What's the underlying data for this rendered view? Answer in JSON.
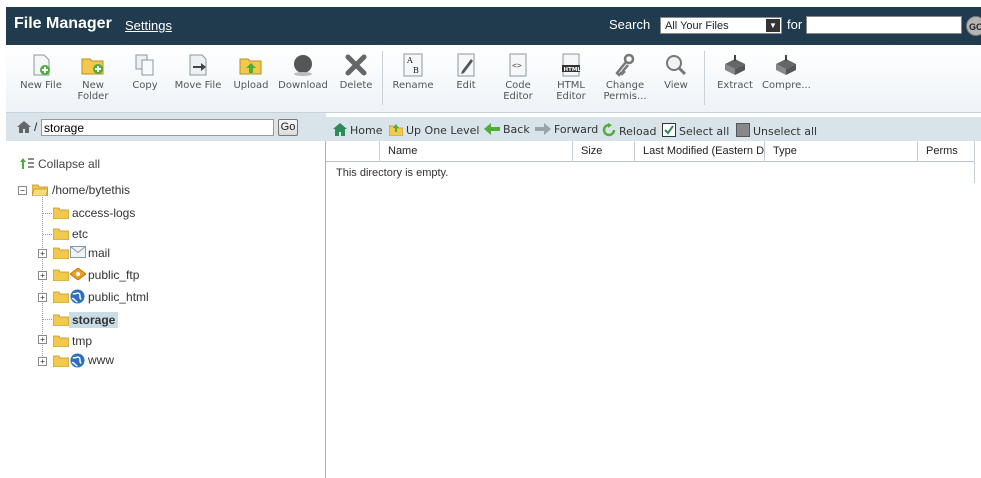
{
  "header": {
    "title": "File Manager",
    "settings": "Settings",
    "search_label": "Search",
    "search_scope": "All Your Files",
    "for_label": "for",
    "search_value": "",
    "go": "GO"
  },
  "toolbar": {
    "new_file": [
      "New File"
    ],
    "new_folder": [
      "New",
      "Folder"
    ],
    "copy": [
      "Copy"
    ],
    "move_file": [
      "Move File"
    ],
    "upload": [
      "Upload"
    ],
    "download": [
      "Download"
    ],
    "delete": [
      "Delete"
    ],
    "rename": [
      "Rename"
    ],
    "edit": [
      "Edit"
    ],
    "code_editor": [
      "Code",
      "Editor"
    ],
    "html_editor": [
      "HTML",
      "Editor"
    ],
    "change_perms": [
      "Change",
      "Permis..."
    ],
    "view": [
      "View"
    ],
    "extract": [
      "Extract"
    ],
    "compress": [
      "Compre..."
    ]
  },
  "path": {
    "slash": "/",
    "value": "storage",
    "go": "Go"
  },
  "tree": {
    "collapse_all": "Collapse all",
    "root": "/home/bytethis",
    "items": [
      {
        "label": "access-logs"
      },
      {
        "label": "etc"
      },
      {
        "label": "mail"
      },
      {
        "label": "public_ftp"
      },
      {
        "label": "public_html"
      },
      {
        "label": "storage"
      },
      {
        "label": "tmp"
      },
      {
        "label": "www"
      }
    ]
  },
  "nav": {
    "home": "Home",
    "up": "Up One Level",
    "back": "Back",
    "forward": "Forward",
    "reload": "Reload",
    "select_all": "Select all",
    "unselect_all": "Unselect all"
  },
  "table": {
    "columns": [
      "Name",
      "Size",
      "Last Modified (Eastern Da",
      "Type",
      "Perms"
    ],
    "empty": "This directory is empty."
  }
}
